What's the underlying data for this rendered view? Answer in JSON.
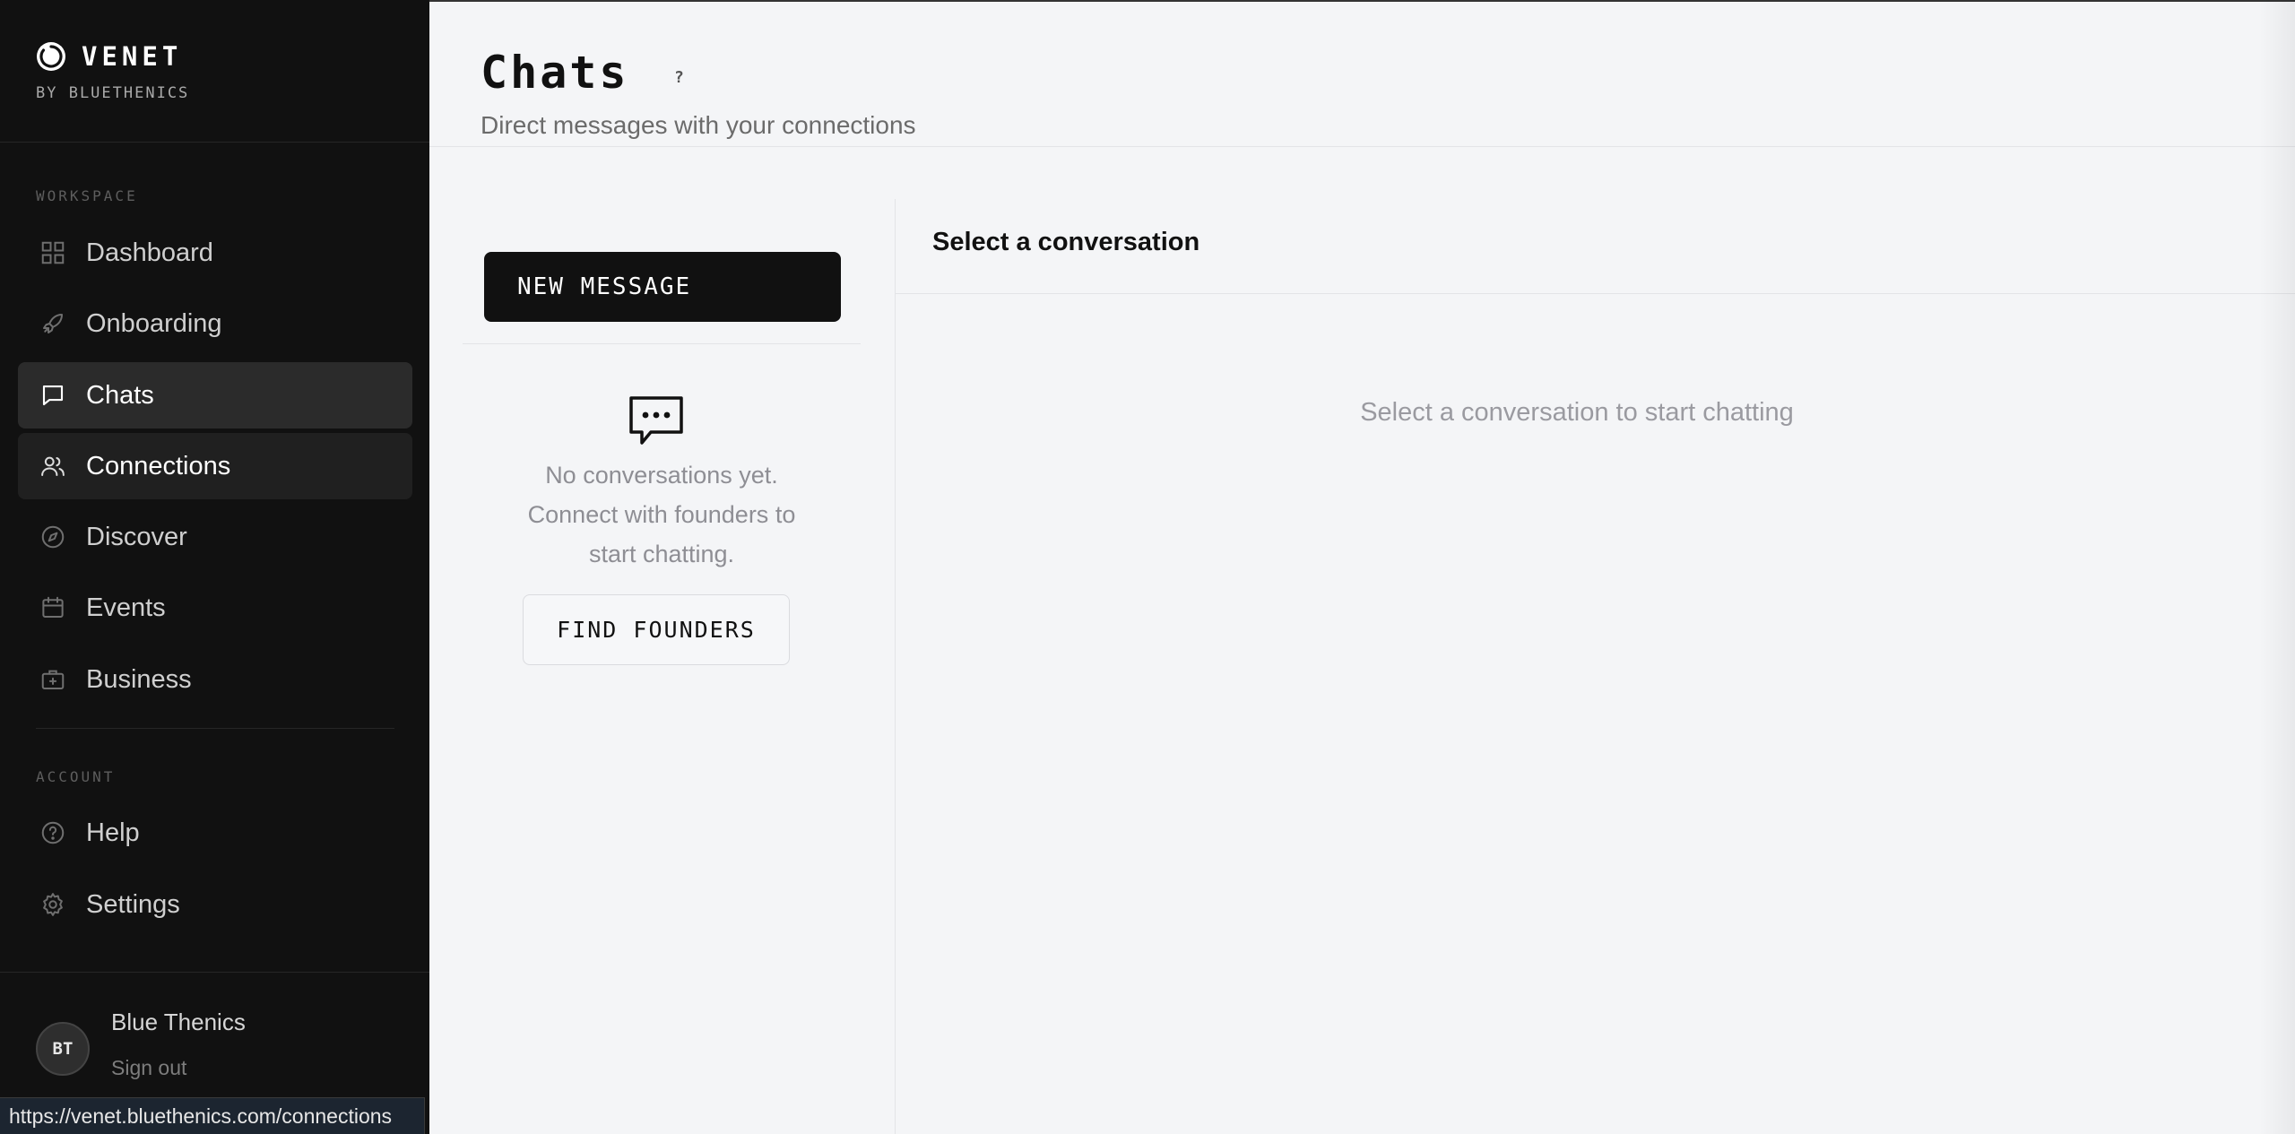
{
  "brand": {
    "name": "VENET",
    "sub": "BY BLUETHENICS"
  },
  "sidebar": {
    "workspace_label": "WORKSPACE",
    "workspace_items": [
      {
        "label": "Dashboard",
        "icon": "grid-icon"
      },
      {
        "label": "Onboarding",
        "icon": "rocket-icon"
      },
      {
        "label": "Chats",
        "icon": "chat-bubble-icon",
        "state": "active"
      },
      {
        "label": "Connections",
        "icon": "users-icon",
        "state": "hover"
      },
      {
        "label": "Discover",
        "icon": "compass-icon"
      },
      {
        "label": "Events",
        "icon": "calendar-icon"
      },
      {
        "label": "Business",
        "icon": "briefcase-icon"
      }
    ],
    "account_label": "ACCOUNT",
    "account_items": [
      {
        "label": "Help",
        "icon": "help-circle-icon"
      },
      {
        "label": "Settings",
        "icon": "gear-icon"
      }
    ]
  },
  "user": {
    "initials": "BT",
    "name": "Blue Thenics",
    "sign_out": "Sign out"
  },
  "status_bar": {
    "url": "https://venet.bluethenics.com/connections"
  },
  "header": {
    "title": "Chats",
    "help": "?",
    "subtitle": "Direct messages with your connections"
  },
  "chat_list": {
    "new_message": "NEW MESSAGE",
    "empty_line1": "No conversations yet.",
    "empty_line2": "Connect with founders to",
    "empty_line3": "start chatting.",
    "find_founders": "FIND FOUNDERS"
  },
  "conversation": {
    "title": "Select a conversation",
    "placeholder": "Select a conversation to start chatting"
  },
  "colors": {
    "sidebar_bg": "#111111",
    "main_bg": "#f4f5f7",
    "accent": "#111111"
  }
}
